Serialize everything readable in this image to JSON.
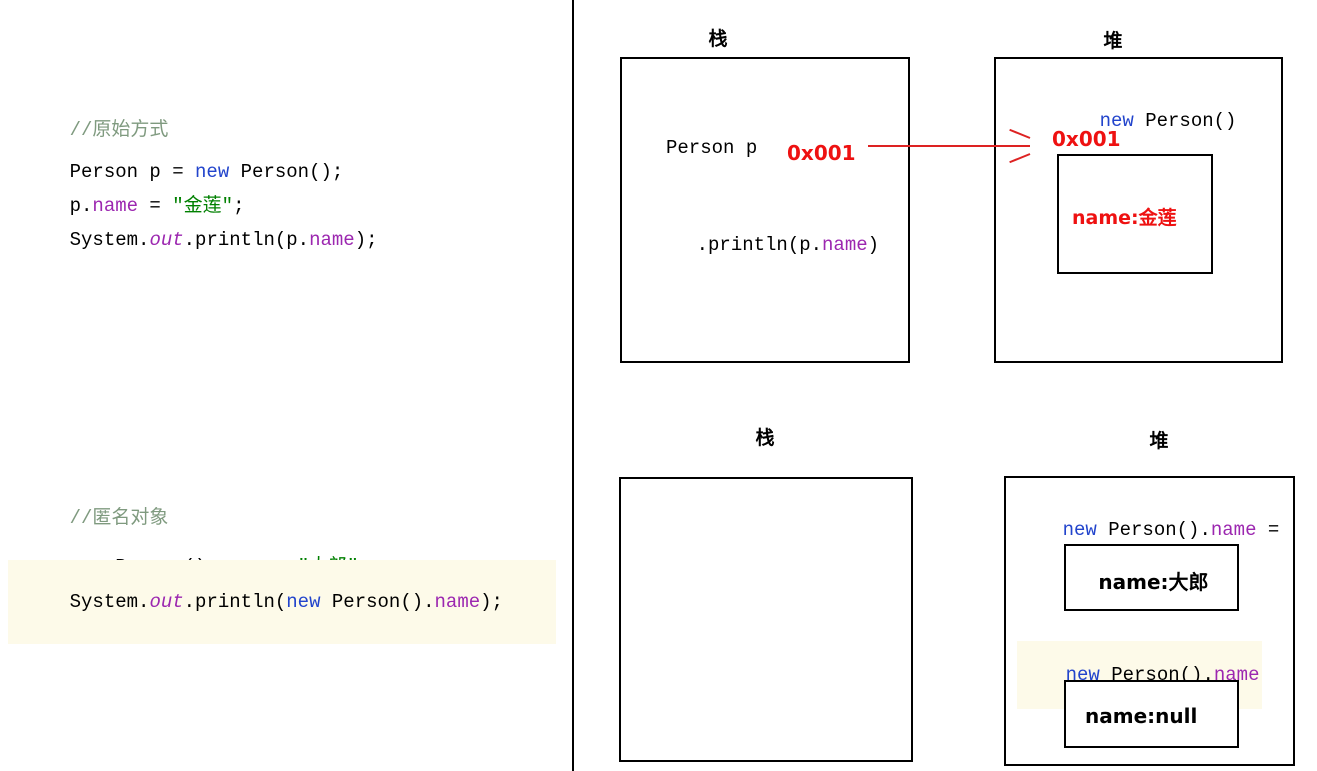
{
  "colors": {
    "keyword": "#2244cc",
    "string": "#008000",
    "comment": "#7f9a7f",
    "field": "#9c27b0",
    "address": "#ee1111",
    "highlight_bg": "#fdfae9",
    "arrow": "#dd2222",
    "border": "#000000"
  },
  "code": {
    "block1": {
      "comment": "//原始方式",
      "line1": {
        "t1": "Person p = ",
        "kw": "new",
        "t2": " Person();"
      },
      "line2": {
        "t1": "p.",
        "fld": "name",
        "t2": " = ",
        "str": "\"金莲\"",
        "t3": ";"
      },
      "line3": {
        "t1": "System.",
        "ital": "out",
        "t2": ".println(p.",
        "fld": "name",
        "t3": ");"
      }
    },
    "block2": {
      "comment": "//匿名对象",
      "line1": {
        "kw": "new",
        "t1": " Person().",
        "fld": "name",
        "t2": " = ",
        "str": "\"大郎\"",
        "t3": ";"
      },
      "line2": {
        "t1": "System.",
        "ital": "out",
        "t2": ".println(",
        "kw": "new",
        "t3": " Person().",
        "fld": "name",
        "t4": ");"
      }
    }
  },
  "diagram": {
    "top": {
      "stack_label": "栈",
      "heap_label": "堆",
      "stack": {
        "var_decl": "Person p",
        "var_address": "0x001",
        "call_line": {
          "t1": ".println(p.",
          "fld": "name",
          "t2": ")"
        }
      },
      "heap": {
        "alloc": {
          "kw": "new",
          "t1": " Person()"
        },
        "address": "0x001",
        "field": "name:金莲"
      },
      "arrow": "pointer-arrow-stack-to-heap"
    },
    "bottom": {
      "stack_label": "栈",
      "heap_label": "堆",
      "stack": {
        "contents": ""
      },
      "heap": {
        "alloc1": {
          "kw": "new",
          "t1": " Person().",
          "fld": "name",
          "t2": " ="
        },
        "field1": "name:大郎",
        "alloc2": {
          "kw": "new",
          "t1": " Person().",
          "fld": "name"
        },
        "field2": "name:null"
      }
    }
  }
}
